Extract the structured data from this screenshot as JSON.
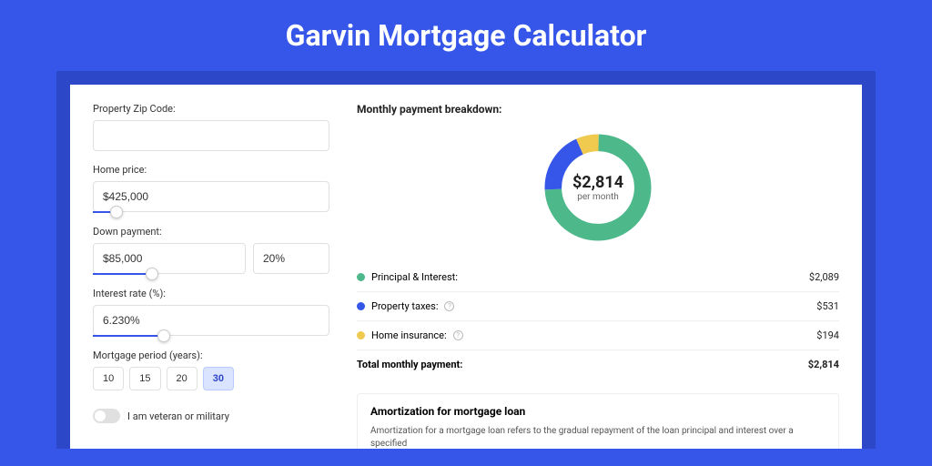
{
  "title": "Garvin Mortgage Calculator",
  "form": {
    "zip_label": "Property Zip Code:",
    "zip_value": "",
    "home_price_label": "Home price:",
    "home_price_value": "$425,000",
    "down_payment_label": "Down payment:",
    "down_payment_value": "$85,000",
    "down_payment_pct": "20%",
    "interest_label": "Interest rate (%):",
    "interest_value": "6.230%",
    "period_label": "Mortgage period (years):",
    "periods": [
      "10",
      "15",
      "20",
      "30"
    ],
    "period_active": "30",
    "veteran_label": "I am veteran or military"
  },
  "breakdown": {
    "title": "Monthly payment breakdown:",
    "center_amount": "$2,814",
    "center_sub": "per month",
    "rows": [
      {
        "label": "Principal & Interest:",
        "amount": "$2,089",
        "color": "green",
        "info": false
      },
      {
        "label": "Property taxes:",
        "amount": "$531",
        "color": "blue",
        "info": true
      },
      {
        "label": "Home insurance:",
        "amount": "$194",
        "color": "yellow",
        "info": true
      }
    ],
    "total_label": "Total monthly payment:",
    "total_amount": "$2,814"
  },
  "amort": {
    "title": "Amortization for mortgage loan",
    "text": "Amortization for a mortgage loan refers to the gradual repayment of the loan principal and interest over a specified"
  },
  "chart_data": {
    "type": "pie",
    "title": "Monthly payment breakdown",
    "series": [
      {
        "name": "Principal & Interest",
        "value": 2089,
        "color": "#4db88a"
      },
      {
        "name": "Property taxes",
        "value": 531,
        "color": "#3556e8"
      },
      {
        "name": "Home insurance",
        "value": 194,
        "color": "#f0c94f"
      }
    ],
    "total": 2814,
    "center_label": "$2,814 per month"
  }
}
